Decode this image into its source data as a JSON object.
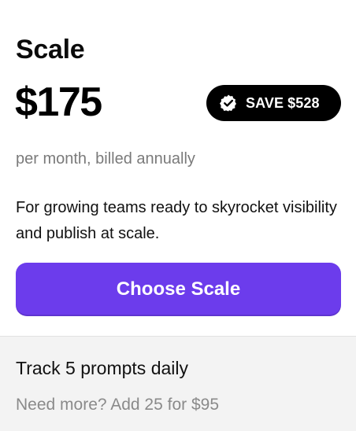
{
  "plan": {
    "name": "Scale",
    "price": "$175",
    "save_badge": {
      "icon": "verified-check-icon",
      "label": "SAVE $528"
    },
    "billing_note": "per month, billed annually",
    "description": "For growing teams ready to skyrocket visibility and publish at scale.",
    "cta_label": "Choose Scale"
  },
  "footer": {
    "feature": "Track 5 prompts daily",
    "addon": "Need more? Add 25 for $95"
  },
  "colors": {
    "accent": "#6c3cec",
    "badge_bg": "#000000",
    "muted_text": "#7a7a7a",
    "footer_bg": "#f3f3f3"
  }
}
